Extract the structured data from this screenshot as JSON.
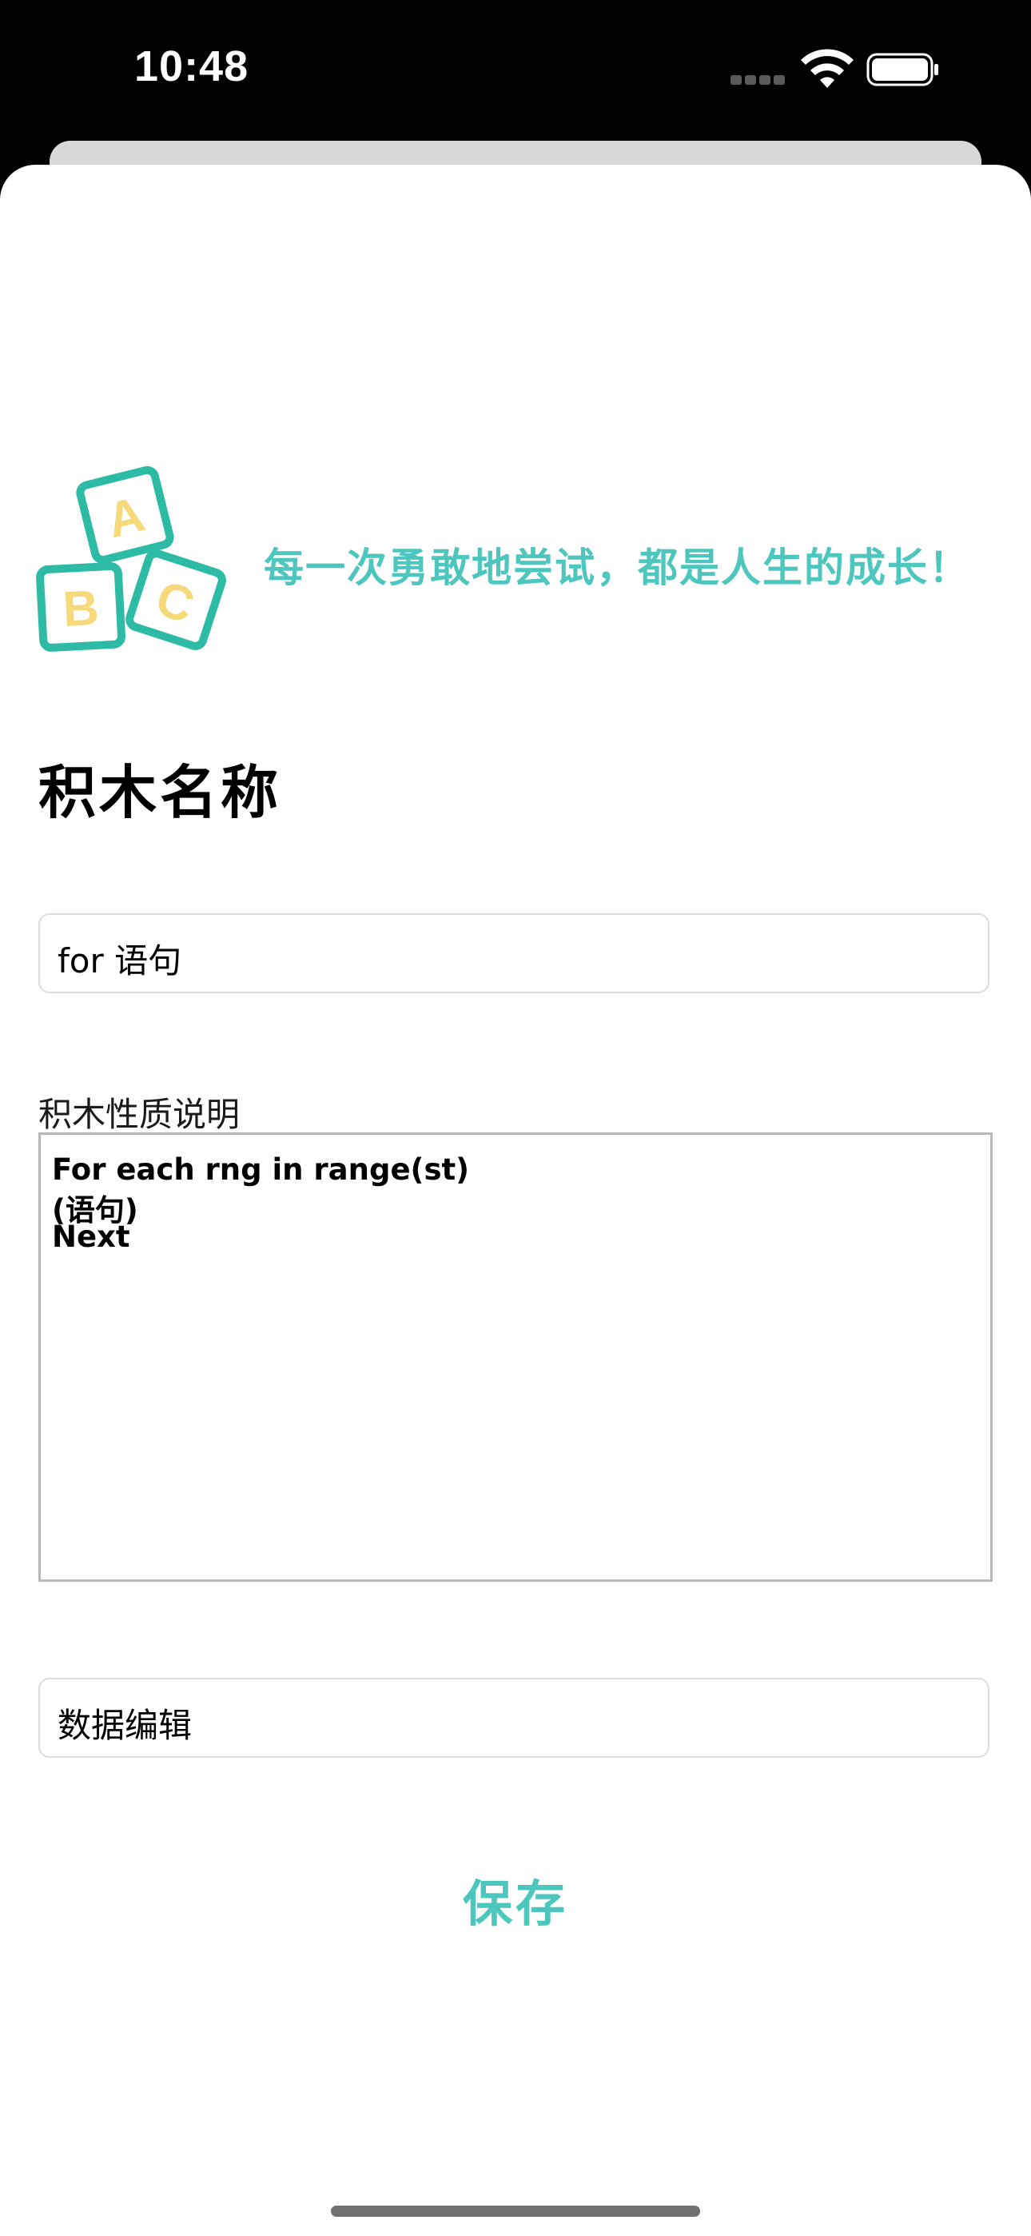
{
  "status_bar": {
    "time": "10:48",
    "icons": [
      "cellular-signal-icon",
      "wifi-icon",
      "battery-icon"
    ]
  },
  "banner": {
    "icon": "abc-blocks-icon",
    "icon_letters": [
      "A",
      "B",
      "C"
    ],
    "slogan": "每一次勇敢地尝试，都是人生的成长！"
  },
  "page_title": "积木名称",
  "name_field": {
    "value": "for 语句"
  },
  "description": {
    "label": "积木性质说明",
    "lines": [
      "For each rng in range(st)",
      "(语句)",
      "Next"
    ]
  },
  "data_field": {
    "value": "数据编辑"
  },
  "save_label": "保存",
  "colors": {
    "accent": "#4dc6bd",
    "block_letter": "#f5d97a",
    "background": "#ffffff",
    "status_bar": "#000000"
  }
}
